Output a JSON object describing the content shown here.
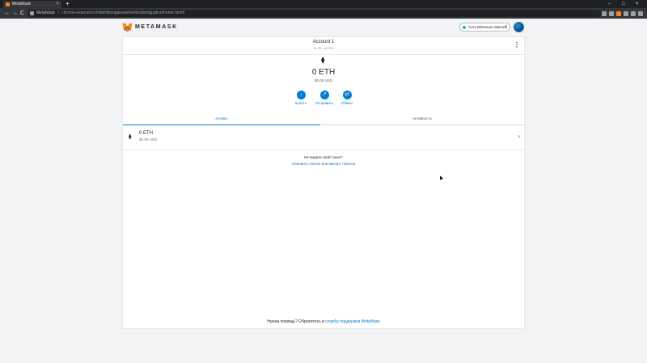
{
  "browser": {
    "tab_title": "MetaMask",
    "tab_close": "×",
    "new_tab": "+",
    "window_controls": [
      "–",
      "□",
      "×"
    ],
    "nav_back": "←",
    "nav_forward": "→",
    "nav_reload": "C",
    "url_site": "MetaMask",
    "url_sep": "|",
    "url_path": "chrome-extension://nkbihfbeogaeaoehlefnkodbefgpgknn/home.html#"
  },
  "header": {
    "wordmark": "METAMASK",
    "network_label": "Сеть Ethereum Mainnet",
    "network_chevron": "▾"
  },
  "account": {
    "name": "Account 1",
    "address": "0x7f5...b9f7f5",
    "menu_icon": "⋮"
  },
  "balance": {
    "primary": "0 ETH",
    "secondary": "$0.00 USD",
    "logo": "⧫"
  },
  "actions": [
    {
      "label": "Купить",
      "glyph": "↓"
    },
    {
      "label": "Отправить",
      "glyph": "↗"
    },
    {
      "label": "Обмен",
      "glyph": "⇄"
    }
  ],
  "tabs": {
    "assets": "Активы",
    "activity": "Активность"
  },
  "asset_list": [
    {
      "amount": "0 ETH",
      "fiat": "$0.00 USD",
      "icon": "⧫",
      "chevron": "›"
    }
  ],
  "token_prompt": {
    "question": "Не видите свой токен?",
    "refresh_link": "Обновить список",
    "or_text": "или",
    "import_link": "импорт токенов"
  },
  "help": {
    "text": "Нужна помощь? Обратитесь в",
    "link": "службу поддержки MetaMask"
  },
  "colors": {
    "accent": "#037dd6",
    "network_dot": "#29b6af",
    "brand_orange": "#f6851b"
  }
}
